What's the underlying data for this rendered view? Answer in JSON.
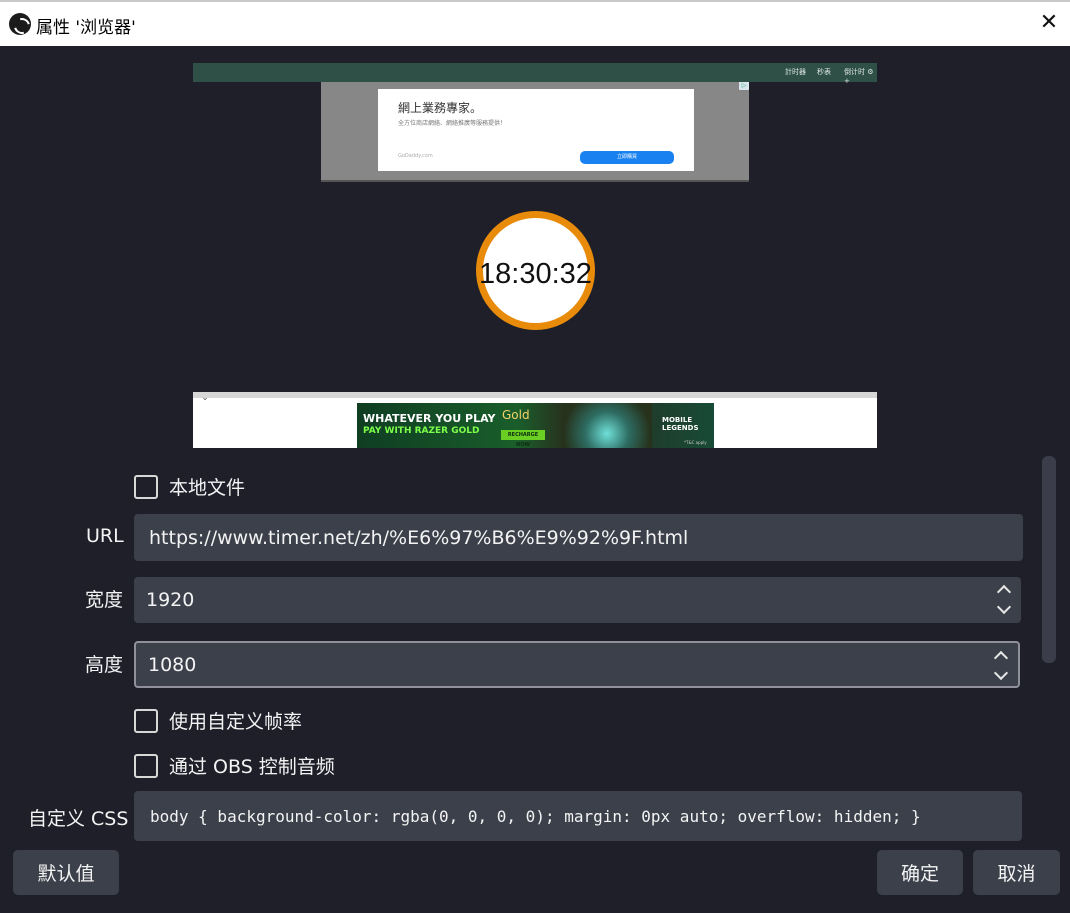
{
  "window": {
    "title": "属性 '浏览器'"
  },
  "preview": {
    "nav_items": [
      "計时器",
      "秒表",
      "倒计时 ⚙ +"
    ],
    "ad_top": {
      "headline": "網上業務專家。",
      "subline": "全方位商店網絡、網絡推廣等服務提供！",
      "footer": "GoDaddy.com",
      "button": "立即購買"
    },
    "clock_time": "18:30:32",
    "ad_bottom": {
      "line1": "WHATEVER YOU PLAY",
      "line2": "PAY WITH RAZER GOLD",
      "gold": "Gold",
      "recharge": "RECHARGE NOW",
      "game": "MOBILE LEGENDS",
      "tc": "*T&C apply"
    }
  },
  "form": {
    "local_file_label": "本地文件",
    "url_label": "URL",
    "url_value": "https://www.timer.net/zh/%E6%97%B6%E9%92%9F.html",
    "width_label": "宽度",
    "width_value": "1920",
    "height_label": "高度",
    "height_value": "1080",
    "custom_fps_label": "使用自定义帧率",
    "obs_audio_label": "通过 OBS 控制音频",
    "css_label": "自定义 CSS",
    "css_value": "body { background-color: rgba(0, 0, 0, 0); margin: 0px auto; overflow: hidden; }"
  },
  "buttons": {
    "defaults": "默认值",
    "ok": "确定",
    "cancel": "取消"
  },
  "colors": {
    "background": "#1e1f29",
    "field": "#3c404b",
    "clock_ring": "#e88b0b"
  }
}
